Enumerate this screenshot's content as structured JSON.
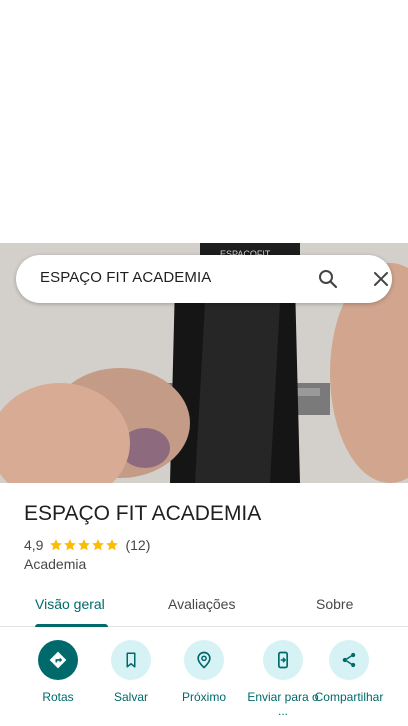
{
  "search": {
    "query": "ESPAÇO FIT ACADEMIA"
  },
  "photo": {
    "sign_text": "ESPAÇOFIT"
  },
  "place": {
    "name": "ESPAÇO FIT ACADEMIA",
    "rating": "4,9",
    "stars": 5,
    "review_count": "(12)",
    "category": "Academia"
  },
  "tabs": [
    {
      "label": "Visão geral",
      "active": true
    },
    {
      "label": "Avaliações",
      "active": false
    },
    {
      "label": "Sobre",
      "active": false
    }
  ],
  "actions": [
    {
      "label": "Rotas",
      "icon": "directions-icon"
    },
    {
      "label": "Salvar",
      "icon": "bookmark-icon"
    },
    {
      "label": "Próximo",
      "icon": "nearby-icon"
    },
    {
      "label": "Enviar para o ...",
      "icon": "send-to-phone-icon"
    },
    {
      "label": "Compartilhar",
      "icon": "share-icon"
    }
  ],
  "colors": {
    "accent": "#00696b",
    "accent_light": "#d6f2f5",
    "star": "#fbbc04"
  }
}
